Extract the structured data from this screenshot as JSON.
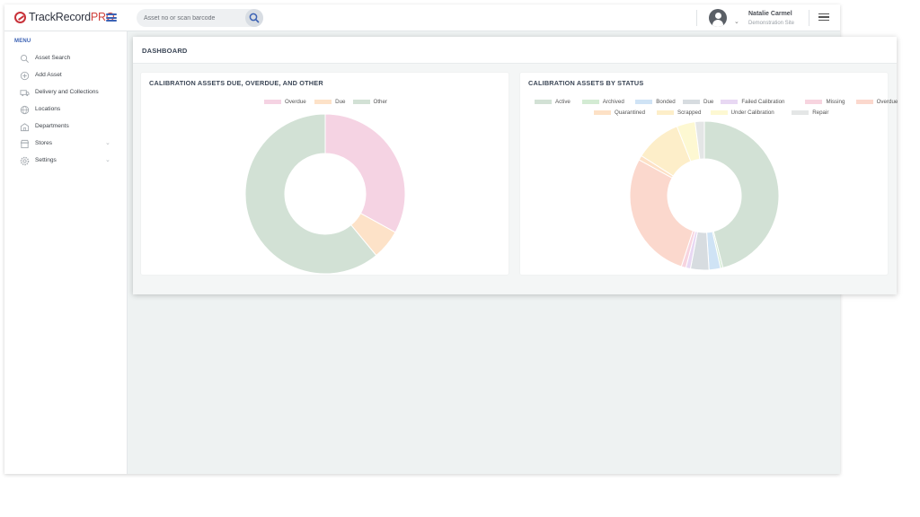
{
  "app": {
    "logo_text": "TrackRecord",
    "logo_pro": "PRO"
  },
  "search": {
    "placeholder": "Asset no or scan barcode"
  },
  "user": {
    "name": "Natalie Carmel",
    "site": "Demonstration Site"
  },
  "sidebar": {
    "menu_title": "MENU",
    "items": [
      {
        "label": "Asset Search",
        "icon": "search-icon",
        "has_chevron": false
      },
      {
        "label": "Add Asset",
        "icon": "add-circle-icon",
        "has_chevron": false
      },
      {
        "label": "Delivery and Collections",
        "icon": "truck-icon",
        "has_chevron": false
      },
      {
        "label": "Locations",
        "icon": "globe-icon",
        "has_chevron": false
      },
      {
        "label": "Departments",
        "icon": "building-icon",
        "has_chevron": false
      },
      {
        "label": "Stores",
        "icon": "store-icon",
        "has_chevron": true
      },
      {
        "label": "Settings",
        "icon": "gear-icon",
        "has_chevron": true
      }
    ]
  },
  "dashboard": {
    "title": "DASHBOARD"
  },
  "chart_data": [
    {
      "type": "pie",
      "title": "CALIBRATION ASSETS DUE, OVERDUE, AND OTHER",
      "donut": true,
      "legend_position": "top",
      "categories": [
        "Overdue",
        "Due",
        "Other"
      ],
      "values": [
        33,
        6,
        61
      ],
      "colors": [
        "#f5d3e3",
        "#fde2c8",
        "#d2e1d5"
      ]
    },
    {
      "type": "pie",
      "title": "CALIBRATION ASSETS BY STATUS",
      "donut": true,
      "legend_position": "top",
      "categories": [
        "Active",
        "Archived",
        "Bonded",
        "Due",
        "Failed Calibration",
        "Missing",
        "Overdue",
        "Quarantined",
        "Scrapped",
        "Under Calibration",
        "Repair"
      ],
      "values": [
        46,
        0.5,
        2.5,
        4,
        1,
        1,
        28,
        1,
        10,
        4,
        2
      ],
      "colors": [
        "#d2e1d5",
        "#d3ebd3",
        "#cfe3f5",
        "#d7dce0",
        "#e8d8f3",
        "#f7d4df",
        "#fbd8cd",
        "#fde1c6",
        "#fdeec9",
        "#fdf8d2",
        "#e4e6e6"
      ]
    }
  ]
}
